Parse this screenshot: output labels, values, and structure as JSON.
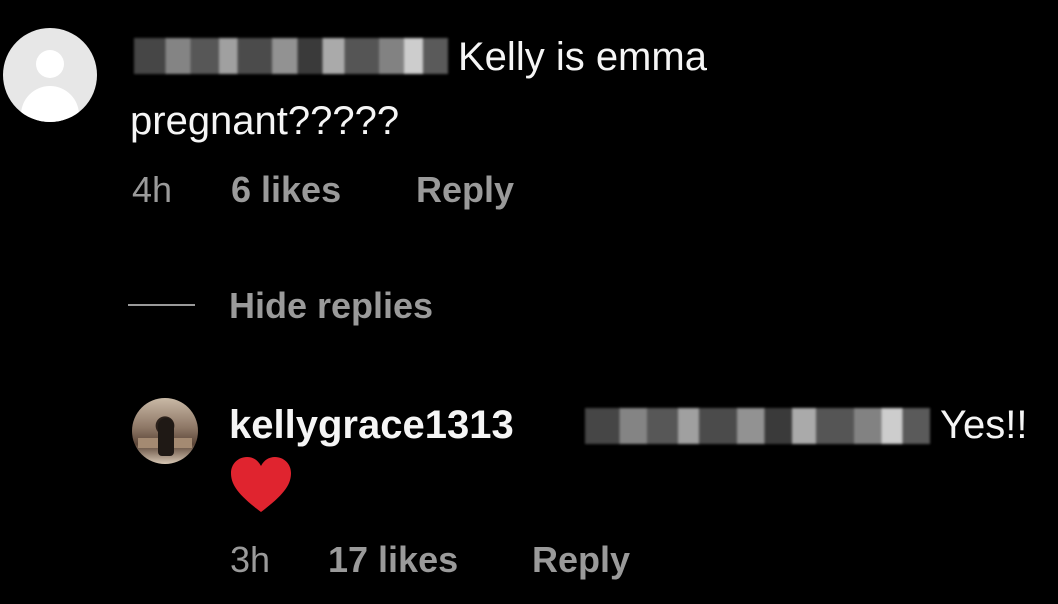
{
  "comment": {
    "text_line1": "Kelly is emma",
    "text_line2": "pregnant?????",
    "time": "4h",
    "likes": "6 likes",
    "reply_label": "Reply",
    "avatar_icon": "default-profile-icon"
  },
  "thread": {
    "hide_replies_label": "Hide replies"
  },
  "reply": {
    "username": "kellygrace1313",
    "text": "Yes!!",
    "emoji": "red-heart-icon",
    "time": "3h",
    "likes": "17 likes",
    "reply_label": "Reply"
  },
  "colors": {
    "background": "#000000",
    "text": "#f5f5f5",
    "meta": "#9a9a9a",
    "heart": "#e0242f"
  }
}
